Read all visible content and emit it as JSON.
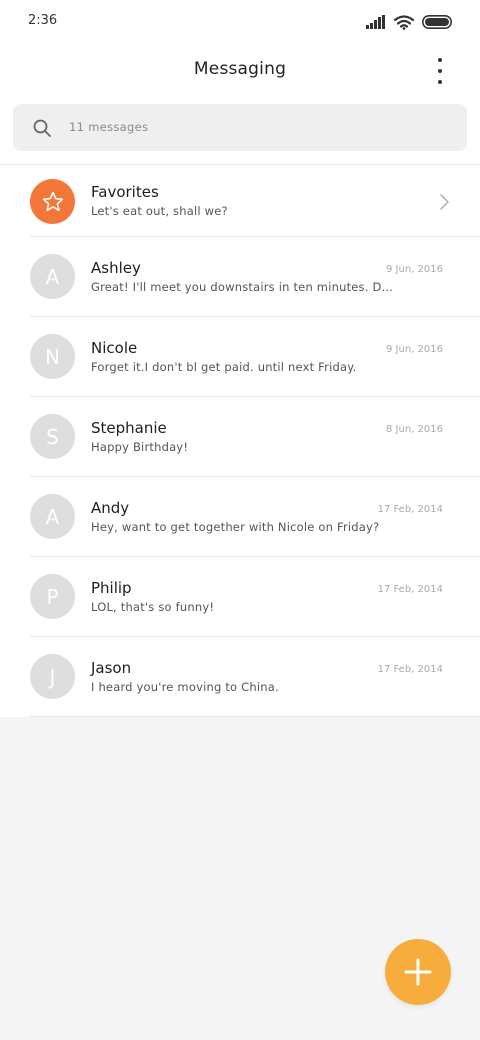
{
  "status_bar": {
    "time": "2:36",
    "icons": [
      "signal-icon",
      "wifi-icon",
      "battery-icon"
    ]
  },
  "header": {
    "title": "Messaging",
    "more_icon": "more-vertical-icon"
  },
  "search": {
    "placeholder": "11 messages",
    "icon": "search-icon"
  },
  "favorites": {
    "name": "Favorites",
    "preview": "Let's eat out, shall we?",
    "icon": "star-icon",
    "chevron": "chevron-right-icon"
  },
  "conversations": [
    {
      "initial": "A",
      "name": "Ashley",
      "preview": "Great! I'll meet you downstairs in ten minutes. Don't be late!",
      "date": "9 Jun, 2016"
    },
    {
      "initial": "N",
      "name": "Nicole",
      "preview": "Forget it.I don't bl get paid. until next Friday.",
      "date": "9 Jun, 2016"
    },
    {
      "initial": "S",
      "name": "Stephanie",
      "preview": "Happy Birthday!",
      "date": "8 Jun, 2016"
    },
    {
      "initial": "A",
      "name": "Andy",
      "preview": "Hey, want to get together with Nicole on Friday?",
      "date": "17 Feb, 2014"
    },
    {
      "initial": "P",
      "name": "Philip",
      "preview": "LOL, that's so funny!",
      "date": "17 Feb, 2014"
    },
    {
      "initial": "J",
      "name": "Jason",
      "preview": "I heard you're moving to China.",
      "date": "17 Feb, 2014"
    }
  ],
  "fab": {
    "icon": "plus-icon"
  },
  "colors": {
    "favorites_accent": "#f4773a",
    "fab": "#f6ad3e",
    "avatar_placeholder": "#dedede",
    "background": "#f5f5f5"
  }
}
